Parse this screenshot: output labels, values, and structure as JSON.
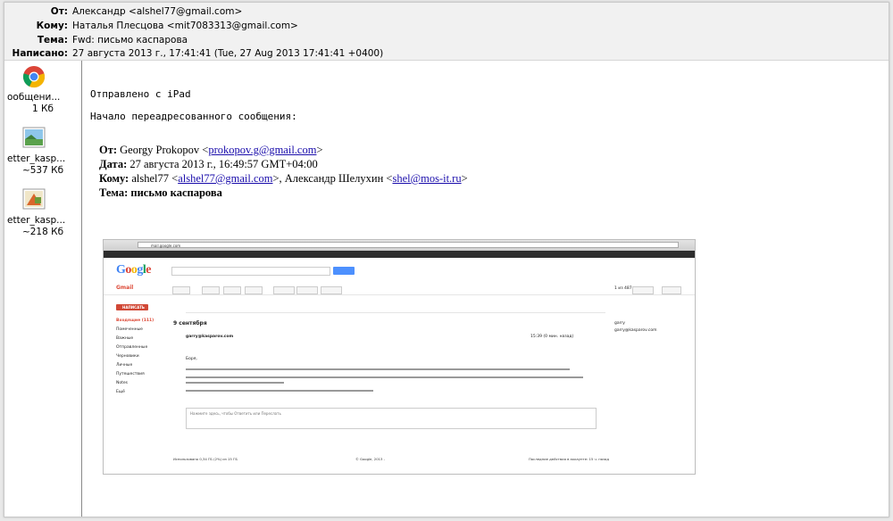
{
  "header": {
    "from_label": "От:",
    "from_value": "Александр <alshel77@gmail.com>",
    "to_label": "Кому:",
    "to_value": "Наталья Плесцова <mit7083313@gmail.com>",
    "subject_label": "Тема:",
    "subject_value": "Fwd: письмо каспарова",
    "date_label": "Написано:",
    "date_value": "27 августа 2013 г., 17:41:41 (Tue, 27 Aug 2013 17:41:41 +0400)"
  },
  "attachments": [
    {
      "name": "ообщени...",
      "size": "1 Кб",
      "icon": "chrome-icon"
    },
    {
      "name": "etter_kasp...",
      "size": "~537 Кб",
      "icon": "image-file-icon"
    },
    {
      "name": "etter_kasp...",
      "size": "~218 Кб",
      "icon": "image-file-icon"
    }
  ],
  "body": {
    "sent_from": "Отправлено с iPad",
    "forward_start": "Начало переадресованного сообщения:",
    "fw_from_label": "От:",
    "fw_from_name": "Georgy Prokopov <",
    "fw_from_email": "prokopov.g@gmail.com",
    "fw_from_tail": ">",
    "fw_date_label": "Дата:",
    "fw_date_value": "27 августа 2013 г., 16:49:57 GMT+04:00",
    "fw_to_label": "Кому:",
    "fw_to_name1": "alshel77 <",
    "fw_to_email1": "alshel77@gmail.com",
    "fw_to_mid": ">, Александр Шелухин <",
    "fw_to_email2": "shel@mos-it.ru",
    "fw_to_tail": ">",
    "fw_subject_label": "Тема:",
    "fw_subject_value": "письмо каспарова"
  },
  "screenshot": {
    "url": "mail.google.com",
    "logo": "Google",
    "gmail_label": "Gmail",
    "compose_label": "НАПИСАТЬ",
    "folders": [
      "Входящие (111)",
      "Помеченные",
      "Важные",
      "Отправленные",
      "Черновики",
      "Личные",
      "Путешествия",
      "Notes",
      "Ещё"
    ],
    "thread_date": "9 сентября",
    "sender": "garry@kasparov.com",
    "time": "15:39 (0 мин. назад)",
    "greeting": "Боря,",
    "reply_hint": "Нажмите здесь, чтобы Ответить или Переслать",
    "right_name": "garry",
    "right_email": "garry@kasparov.com",
    "footer_left": "Использовано 0,34 ГБ (2%) из 15 ГБ",
    "footer_mid": "© Google, 2013 -",
    "footer_right": "Последние действия в аккаунте: 15 ч. назад",
    "pager": "1 из 487"
  }
}
